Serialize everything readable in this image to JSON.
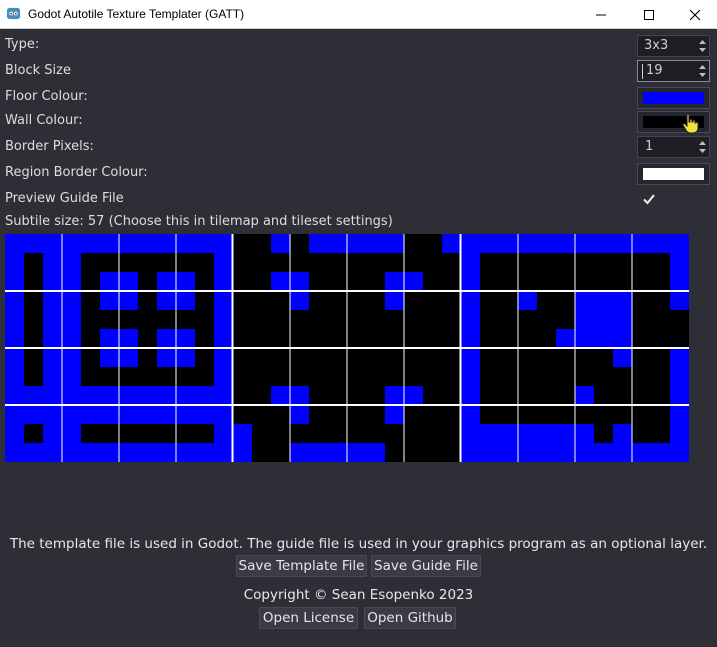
{
  "window": {
    "title": "Godot Autotile Texture Templater (GATT)"
  },
  "form": {
    "type_label": "Type:",
    "type_value": "3x3",
    "block_size_label": "Block Size",
    "block_size_value": "19",
    "floor_colour_label": "Floor Colour:",
    "floor_colour": "#0000ff",
    "wall_colour_label": "Wall Colour:",
    "wall_colour": "#000000",
    "border_pixels_label": "Border Pixels:",
    "border_pixels_value": "1",
    "region_border_colour_label": "Region Border Colour:",
    "region_border_colour": "#ffffff",
    "preview_guide_label": "Preview Guide File",
    "preview_guide_checked": true
  },
  "subtile_info": "Subtile size: 57 (Choose this in tilemap and tileset settings)",
  "footer": {
    "description": "The template file is used in Godot. The guide file is used in your graphics program as an optional layer.",
    "save_template_label": "Save Template File",
    "save_guide_label": "Save Guide File",
    "copyright": "Copyright © Sean Esopenko 2023",
    "open_license_label": "Open License",
    "open_github_label": "Open Github"
  },
  "icons": [
    "godot-app-icon",
    "minimize-icon",
    "maximize-icon",
    "close-icon",
    "spin-arrows-icon",
    "checkmark-icon",
    "hand-pointer-icon"
  ]
}
